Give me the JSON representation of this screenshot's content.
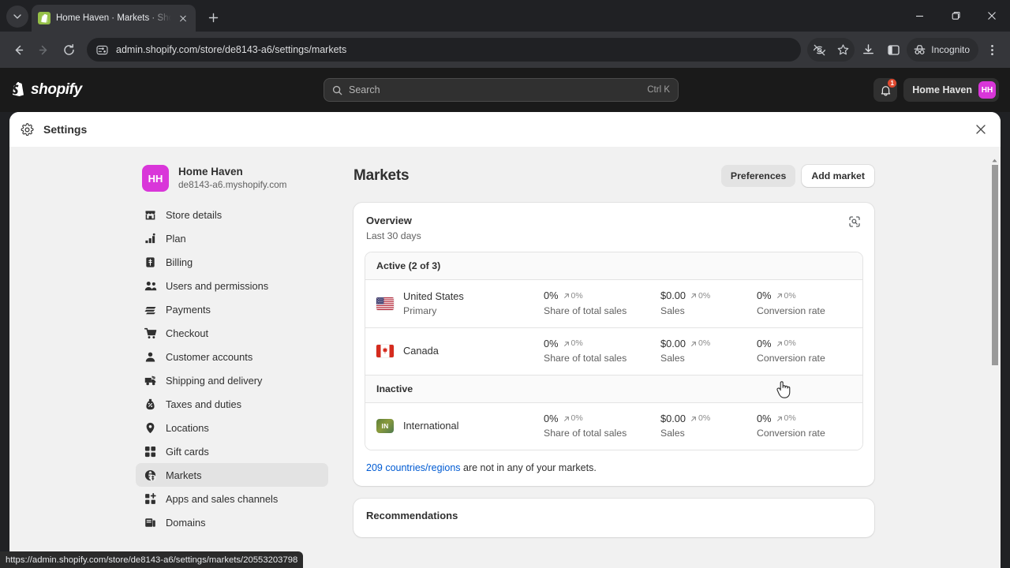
{
  "browser": {
    "tab": {
      "title": "Home Haven · Markets · Shopify",
      "favicon": "shopify-favicon"
    },
    "new_tab_label": "+",
    "url": "admin.shopify.com/store/de8143-a6/settings/markets",
    "profile_label": "Incognito",
    "status_url": "https://admin.shopify.com/store/de8143-a6/settings/markets/20553203798",
    "window_controls": [
      "minimize",
      "maximize",
      "close"
    ]
  },
  "shopify_header": {
    "logo_text": "shopify",
    "search": {
      "placeholder": "Search",
      "shortcut": "Ctrl K"
    },
    "notifications_count": "1",
    "store_name": "Home Haven",
    "store_initials": "HH"
  },
  "modal": {
    "title": "Settings",
    "close_label": "×"
  },
  "sidebar": {
    "store": {
      "initials": "HH",
      "name": "Home Haven",
      "domain": "de8143-a6.myshopify.com"
    },
    "items": [
      {
        "label": "Store details",
        "icon": "store-icon",
        "active": false
      },
      {
        "label": "Plan",
        "icon": "chart-icon",
        "active": false
      },
      {
        "label": "Billing",
        "icon": "billing-icon",
        "active": false
      },
      {
        "label": "Users and permissions",
        "icon": "users-icon",
        "active": false
      },
      {
        "label": "Payments",
        "icon": "payments-icon",
        "active": false
      },
      {
        "label": "Checkout",
        "icon": "cart-icon",
        "active": false
      },
      {
        "label": "Customer accounts",
        "icon": "person-icon",
        "active": false
      },
      {
        "label": "Shipping and delivery",
        "icon": "truck-icon",
        "active": false
      },
      {
        "label": "Taxes and duties",
        "icon": "tax-icon",
        "active": false
      },
      {
        "label": "Locations",
        "icon": "pin-icon",
        "active": false
      },
      {
        "label": "Gift cards",
        "icon": "gift-card-icon",
        "active": false
      },
      {
        "label": "Markets",
        "icon": "globe-icon",
        "active": true
      },
      {
        "label": "Apps and sales channels",
        "icon": "apps-icon",
        "active": false
      },
      {
        "label": "Domains",
        "icon": "domain-icon",
        "active": false
      }
    ]
  },
  "main": {
    "page_title": "Markets",
    "actions": [
      {
        "label": "Preferences",
        "style": "plain"
      },
      {
        "label": "Add market",
        "style": "white"
      }
    ],
    "overview": {
      "title": "Overview",
      "subtitle": "Last 30 days",
      "report_icon": "view-report-icon",
      "groups": [
        {
          "heading": "Active (2 of 3)",
          "rows": [
            {
              "icon": "flag-us",
              "name": "United States",
              "subtitle": "Primary",
              "metrics": [
                {
                  "value": "0%",
                  "delta": "0%",
                  "delta_dir": "up",
                  "label": "Share of total sales"
                },
                {
                  "value": "$0.00",
                  "delta": "0%",
                  "delta_dir": "up",
                  "label": "Sales"
                },
                {
                  "value": "0%",
                  "delta": "0%",
                  "delta_dir": "up",
                  "label": "Conversion rate"
                }
              ]
            },
            {
              "icon": "flag-ca",
              "name": "Canada",
              "subtitle": "",
              "metrics": [
                {
                  "value": "0%",
                  "delta": "0%",
                  "delta_dir": "up",
                  "label": "Share of total sales"
                },
                {
                  "value": "$0.00",
                  "delta": "0%",
                  "delta_dir": "up",
                  "label": "Sales"
                },
                {
                  "value": "0%",
                  "delta": "0%",
                  "delta_dir": "up",
                  "label": "Conversion rate"
                }
              ]
            }
          ]
        },
        {
          "heading": "Inactive",
          "rows": [
            {
              "icon": "badge-in",
              "badge_text": "IN",
              "name": "International",
              "subtitle": "",
              "metrics": [
                {
                  "value": "0%",
                  "delta": "0%",
                  "delta_dir": "up",
                  "label": "Share of total sales"
                },
                {
                  "value": "$0.00",
                  "delta": "0%",
                  "delta_dir": "up",
                  "label": "Sales"
                },
                {
                  "value": "0%",
                  "delta": "0%",
                  "delta_dir": "up",
                  "label": "Conversion rate"
                }
              ]
            }
          ]
        }
      ],
      "footer_link": "209 countries/regions",
      "footer_rest": " are not in any of your markets."
    },
    "recommendations": {
      "title": "Recommendations"
    }
  },
  "colors": {
    "brand_magenta": "#d936d9",
    "link_blue": "#005bd3",
    "badge_red": "#e0492f",
    "shopify_green": "#95bf47"
  }
}
